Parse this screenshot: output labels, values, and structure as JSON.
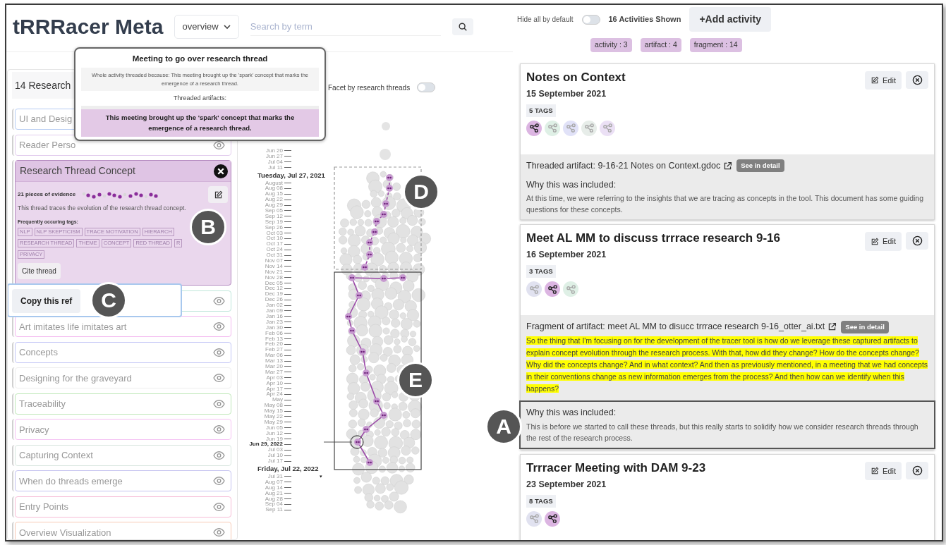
{
  "header": {
    "title": "tRRRacer Meta",
    "view_select": "overview",
    "search": {
      "placeholder": "Search by term"
    }
  },
  "tooltip": {
    "title": "Meeting to go over research thread",
    "reason": "Whole activity threaded because: This meeting brought up the 'spark' concept that marks the emergence of a research thread.",
    "artifacts_heading": "Threaded artifacts:",
    "artifacts": [
      "This meeting brought up the 'spark' concept that marks the emergence of a research thread."
    ]
  },
  "threads_panel": {
    "heading": "14 Research",
    "threads": [
      {
        "name": "UI and Desig",
        "color": "#b7cdf3",
        "expanded": false
      },
      {
        "name": "Reader Perso",
        "color": "#e3cdee",
        "expanded": false
      },
      {
        "name": "Research Thread Concept",
        "color": "#b58bc0",
        "expanded": true,
        "callout": "B",
        "evidence": "21 pieces of evidence",
        "description": "This thread traces the evolution of the research thread concept.",
        "tags_heading": "Frequently occuring tags:",
        "tags": [
          "NLP",
          "NLP SKEPTICISM",
          "TRACE MOTIVATION",
          "HIERARCH",
          "RESEARCH THREAD",
          "THEME",
          "CONCEPT",
          "RED THREAD",
          "R",
          "PRIVACY"
        ],
        "cite": "Cite thread"
      },
      {
        "color": "#bfe6da",
        "expanded": false,
        "popover": {
          "button": "Copy this ref",
          "callout": "C"
        }
      },
      {
        "name": "Art imitates life imitates art",
        "color": "#f3b8ef",
        "expanded": false
      },
      {
        "name": "Concepts",
        "color": "#c3c6f6",
        "expanded": false
      },
      {
        "name": "Designing for the graveyard",
        "color": "#ededed",
        "expanded": false
      },
      {
        "name": "Traceability",
        "color": "#bfe8b8",
        "expanded": false
      },
      {
        "name": "Privacy",
        "color": "#f5c2f4",
        "expanded": false
      },
      {
        "name": "Capturing Context",
        "color": "#d8e6df",
        "expanded": false
      },
      {
        "name": "When do threads emerge",
        "color": "#c4c2ef",
        "expanded": false
      },
      {
        "name": "Entry Points",
        "color": "#f7bcd6",
        "expanded": false
      },
      {
        "name": "Overview Visualization",
        "color": "#f7c9b5",
        "expanded": false
      }
    ]
  },
  "timeline": {
    "facet": {
      "label": "Facet by research threads",
      "on": false
    },
    "axis": [
      {
        "label": "Jun 20",
        "kind": "tick"
      },
      {
        "label": "Jun 27",
        "kind": "tick"
      },
      {
        "label": "Jul 04",
        "kind": "tick"
      },
      {
        "label": "Jul 11",
        "kind": "tick"
      },
      {
        "label": "Tuesday, Jul 27, 2021",
        "kind": "brush_start"
      },
      {
        "label": "August",
        "kind": "tick"
      },
      {
        "label": "Aug 08",
        "kind": "tick"
      },
      {
        "label": "Aug 15",
        "kind": "tick"
      },
      {
        "label": "Aug 22",
        "kind": "tick"
      },
      {
        "label": "Aug 29",
        "kind": "tick"
      },
      {
        "label": "Sep 05",
        "kind": "tick"
      },
      {
        "label": "Sep 12",
        "kind": "tick"
      },
      {
        "label": "Sep 19",
        "kind": "tick"
      },
      {
        "label": "Sep 26",
        "kind": "tick"
      },
      {
        "label": "Oct 03",
        "kind": "tick"
      },
      {
        "label": "Oct 10",
        "kind": "tick"
      },
      {
        "label": "Oct 17",
        "kind": "tick"
      },
      {
        "label": "Oct 24",
        "kind": "tick"
      },
      {
        "label": "Oct 31",
        "kind": "tick"
      },
      {
        "label": "Nov 07",
        "kind": "tick"
      },
      {
        "label": "Nov 14",
        "kind": "tick"
      },
      {
        "label": "Nov 21",
        "kind": "tick"
      },
      {
        "label": "Nov 28",
        "kind": "tick"
      },
      {
        "label": "Dec 05",
        "kind": "tick"
      },
      {
        "label": "Dec 12",
        "kind": "tick"
      },
      {
        "label": "Dec 19",
        "kind": "tick"
      },
      {
        "label": "Dec 26",
        "kind": "tick"
      },
      {
        "label": "Jan 02",
        "kind": "tick"
      },
      {
        "label": "Jan 09",
        "kind": "tick"
      },
      {
        "label": "Jan 16",
        "kind": "tick"
      },
      {
        "label": "Jan 23",
        "kind": "tick"
      },
      {
        "label": "Jan 30",
        "kind": "tick"
      },
      {
        "label": "Feb 06",
        "kind": "tick"
      },
      {
        "label": "Feb 13",
        "kind": "tick"
      },
      {
        "label": "Feb 20",
        "kind": "tick"
      },
      {
        "label": "Feb 27",
        "kind": "tick"
      },
      {
        "label": "Mar 06",
        "kind": "tick"
      },
      {
        "label": "Mar 13",
        "kind": "tick"
      },
      {
        "label": "Mar 20",
        "kind": "tick"
      },
      {
        "label": "Mar 27",
        "kind": "tick"
      },
      {
        "label": "Apr 03",
        "kind": "tick"
      },
      {
        "label": "Apr 10",
        "kind": "tick"
      },
      {
        "label": "Apr 17",
        "kind": "tick"
      },
      {
        "label": "Apr 24",
        "kind": "tick"
      },
      {
        "label": "May",
        "kind": "tick"
      },
      {
        "label": "May 08",
        "kind": "tick"
      },
      {
        "label": "May 15",
        "kind": "tick"
      },
      {
        "label": "May 22",
        "kind": "tick"
      },
      {
        "label": "May 29",
        "kind": "tick"
      },
      {
        "label": "Jun 05",
        "kind": "tick"
      },
      {
        "label": "Jun 12",
        "kind": "tick"
      },
      {
        "label": "Jun 19",
        "kind": "tick"
      },
      {
        "label": "Jun 29, 2022",
        "kind": "hover"
      },
      {
        "label": "Jul 03",
        "kind": "tick"
      },
      {
        "label": "Jul 10",
        "kind": "tick"
      },
      {
        "label": "Jul 17",
        "kind": "tick"
      },
      {
        "label": "Friday, Jul 22, 2022",
        "kind": "brush_end"
      },
      {
        "label": "Jul 31",
        "kind": "tick"
      },
      {
        "label": "Aug 07",
        "kind": "tick"
      },
      {
        "label": "Aug 14",
        "kind": "tick"
      },
      {
        "label": "Aug 21",
        "kind": "tick"
      },
      {
        "label": "Aug 28",
        "kind": "tick"
      },
      {
        "label": "Sep 04",
        "kind": "tick"
      },
      {
        "label": "Sep 11",
        "kind": "tick"
      }
    ],
    "selections": [
      {
        "kind": "dashed",
        "callout": "D"
      },
      {
        "kind": "solid",
        "callout": "E"
      }
    ]
  },
  "activities_panel": {
    "hide_default": {
      "label": "Hide all by default",
      "on": false
    },
    "count": "16 Activities Shown",
    "add_button": "+Add activity",
    "type_counts": [
      "activity : 3",
      "artifact : 4",
      "fragment : 14"
    ],
    "activities": [
      {
        "title": "Notes on Context",
        "date": "15 September 2021",
        "tag_count": "5 TAGS",
        "edit": "Edit",
        "tags": [
          {
            "color": "#dcb5e2",
            "selected": true
          },
          {
            "color": "#dff0e6",
            "selected": false
          },
          {
            "color": "#e1e2f8",
            "selected": false
          },
          {
            "color": "#e7ede9",
            "selected": false
          },
          {
            "color": "#ebe0f5",
            "selected": false
          }
        ],
        "detail": {
          "kind": "artifact",
          "label": "Threaded artifact: 9-16-21 Notes on Context.gdoc",
          "button": "See in detail",
          "why_heading": "Why this was included:",
          "why": "At this time, we were referring to the insights that we are tracing as concepts in the tool. This document has some guiding questions for these concepts."
        }
      },
      {
        "title": "Meet AL MM to discuss trrrace research 9-16",
        "date": "16 September 2021",
        "tag_count": "3 TAGS",
        "edit": "Edit",
        "tags": [
          {
            "color": "#e1e2f0",
            "selected": false
          },
          {
            "color": "#dcb5e2",
            "selected": true
          },
          {
            "color": "#dff0e6",
            "selected": false
          }
        ],
        "detail": {
          "kind": "fragment",
          "label": "Fragment of artifact: meet AL MM to disucc trrrace research 9-16_otter_ai.txt",
          "button": "See in detail",
          "quote": "So the thing that I'm focusing on for the development of the tracer tool is how do we leverage these captured artifacts to explain concept evolution through the research process. With that, how did they change? How do the concepts change? Why did the concepts change? And in what context? And then as previously mentioned, in a meeting that we had concepts in their conventions change as new information emerges from the process? And then how can we identify when this happens?",
          "why_heading": "Why this was included:",
          "why": "This is before we started to call these threads, but this really starts to solidify how we consider research threads through the rest of the research process.",
          "callout": "A"
        }
      },
      {
        "title": "Trrracer Meeting with DAM 9-23",
        "date": "23 September 2021",
        "tag_count": "8 TAGS",
        "edit": "Edit",
        "tags": [
          {
            "color": "#e1e2f0",
            "selected": false
          },
          {
            "color": "#dcb5e2",
            "selected": true
          }
        ]
      }
    ]
  }
}
